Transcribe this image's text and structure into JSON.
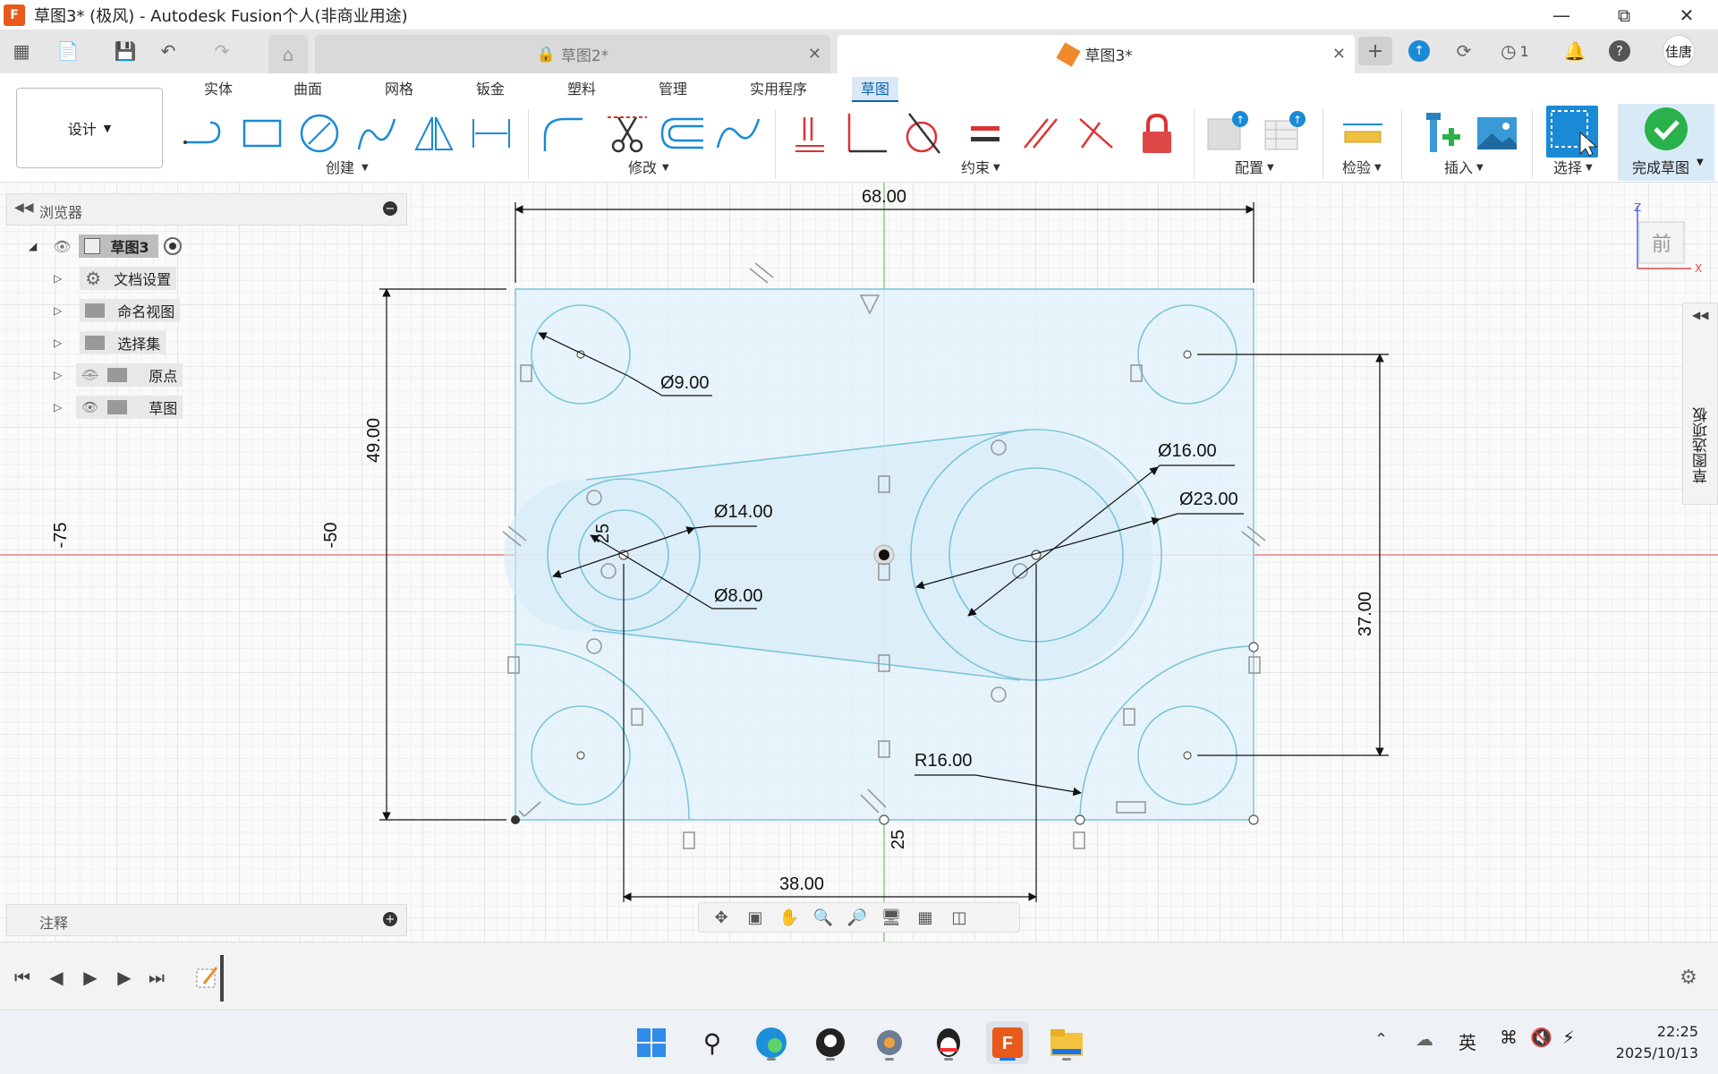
{
  "app": {
    "title": "草图3* (极风) - Autodesk Fusion个人(非商业用途)",
    "logo_text": "F",
    "user": "佳唐",
    "job_count": "1"
  },
  "tabs": {
    "inactive_label": "草图2*",
    "active_label": "草图3*"
  },
  "ribbon": {
    "tabs": [
      "实体",
      "曲面",
      "网格",
      "钣金",
      "塑料",
      "管理",
      "实用程序",
      "草图"
    ],
    "design_label": "设计",
    "groups": {
      "create": "创建",
      "modify": "修改",
      "constrain": "约束",
      "config": "配置",
      "inspect": "检验",
      "insert": "插入",
      "select": "选择",
      "finish": "完成草图"
    }
  },
  "browser": {
    "header": "浏览器",
    "root": "草图3",
    "items": [
      "文档设置",
      "命名视图",
      "选择集",
      "原点",
      "草图"
    ]
  },
  "notes": {
    "header": "注释"
  },
  "right_panel": {
    "label": "草图选项板"
  },
  "viewcube": {
    "face": "前",
    "z": "Z",
    "x": "X"
  },
  "dimensions": {
    "width": "68.00",
    "height": "49.00",
    "d_small": "Ø9.00",
    "d14": "Ø14.00",
    "d8": "Ø8.00",
    "d16": "Ø16.00",
    "d23": "Ø23.00",
    "v37": "37.00",
    "r16": "R16.00",
    "h38": "38.00",
    "coord_neg75": "-75",
    "coord_neg50": "-50",
    "coord_25a": "25",
    "coord_25b": "25"
  },
  "taskbar": {
    "ime": "英",
    "time": "22:25",
    "date": "2025/10/13"
  },
  "colors": {
    "sketch_line": "#7cc4dc",
    "sketch_fill": "#e6f3fa",
    "x_axis": "#e86a6a",
    "y_axis": "#6ac46a",
    "accent": "#0a66b2",
    "fusion_orange": "#e8591a",
    "finish_green": "#2ab24a"
  }
}
